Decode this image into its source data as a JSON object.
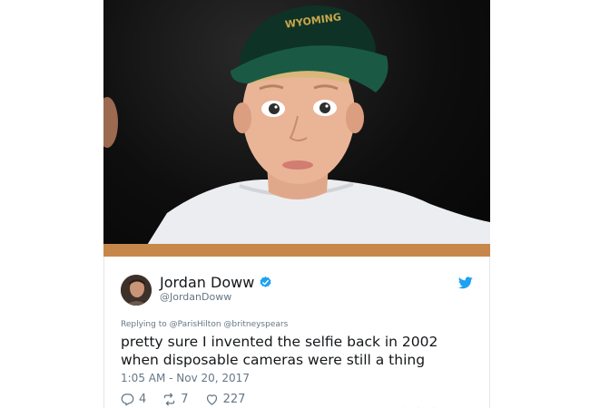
{
  "photo": {
    "alt": "boy selfie",
    "cap_text": "WYOMING"
  },
  "tweet": {
    "author_name": "Jordan Doww",
    "author_handle": "@JordanDoww",
    "verified": true,
    "replying_prefix": "Replying to ",
    "reply_mentions": [
      "@ParisHilton",
      "@britneyspears"
    ],
    "text": "pretty sure I invented the selfie back in 2002 when disposable cameras were still a thing",
    "timestamp": "1:05 AM - Nov 20, 2017",
    "replies": "4",
    "retweets": "7",
    "likes": "227"
  },
  "colors": {
    "verified_blue": "#1da1f2",
    "twitter_blue": "#1da1f2",
    "muted_text": "#657786"
  },
  "icons": [
    "verified-icon",
    "twitter-bird-icon",
    "reply-icon",
    "retweet-icon",
    "heart-icon"
  ]
}
